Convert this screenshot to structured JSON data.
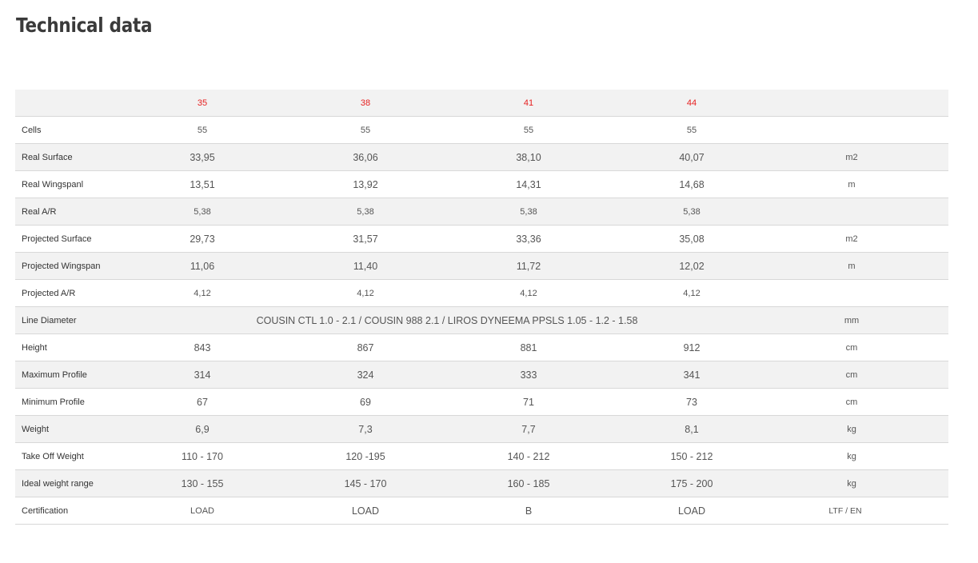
{
  "title": "Technical data",
  "table": {
    "sizes": [
      "35",
      "38",
      "41",
      "44"
    ],
    "rows": [
      {
        "label": "Cells",
        "values": [
          "55",
          "55",
          "55",
          "55"
        ],
        "unit": ""
      },
      {
        "label": "Real Surface",
        "values": [
          "33,95",
          "36,06",
          "38,10",
          "40,07"
        ],
        "unit": "m2"
      },
      {
        "label": "Real Wingspanl",
        "values": [
          "13,51",
          "13,92",
          "14,31",
          "14,68"
        ],
        "unit": "m"
      },
      {
        "label": "Real A/R",
        "values": [
          "5,38",
          "5,38",
          "5,38",
          "5,38"
        ],
        "unit": ""
      },
      {
        "label": "Projected Surface",
        "values": [
          "29,73",
          "31,57",
          "33,36",
          "35,08"
        ],
        "unit": "m2"
      },
      {
        "label": "Projected Wingspan",
        "values": [
          "11,06",
          "11,40",
          "11,72",
          "12,02"
        ],
        "unit": "m"
      },
      {
        "label": "Projected A/R",
        "values": [
          "4,12",
          "4,12",
          "4,12",
          "4,12"
        ],
        "unit": ""
      },
      {
        "label": "Line Diameter",
        "merged_value": "COUSIN CTL 1.0 - 2.1 / COUSIN 988 2.1 / LIROS DYNEEMA PPSLS 1.05 - 1.2 - 1.58",
        "unit": "mm"
      },
      {
        "label": "Height",
        "values": [
          "843",
          "867",
          "881",
          "912"
        ],
        "unit": "cm"
      },
      {
        "label": "Maximum Profile",
        "values": [
          "314",
          "324",
          "333",
          "341"
        ],
        "unit": "cm"
      },
      {
        "label": "Minimum Profile",
        "values": [
          "67",
          "69",
          "71",
          "73"
        ],
        "unit": "cm"
      },
      {
        "label": "Weight",
        "values": [
          "6,9",
          "7,3",
          "7,7",
          "8,1"
        ],
        "unit": "kg"
      },
      {
        "label": "Take Off Weight",
        "values": [
          "110 - 170",
          "120 -195",
          "140 - 212",
          "150 - 212"
        ],
        "unit": "kg"
      },
      {
        "label": "Ideal weight range",
        "values": [
          "130 - 155",
          "145 - 170",
          "160 - 185",
          "175 - 200"
        ],
        "unit": "kg"
      },
      {
        "label": "Certification",
        "values": [
          "LOAD",
          "LOAD",
          "B",
          "LOAD"
        ],
        "unit": "LTF / EN"
      }
    ]
  },
  "colors": {
    "size_header": "#e62020",
    "row_stripe": "#f2f2f2",
    "title": "#3a3a3a"
  }
}
